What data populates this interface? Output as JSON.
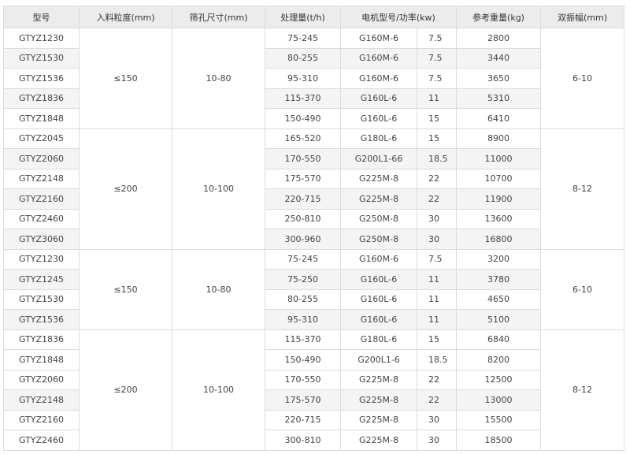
{
  "headers": [
    "型号",
    "入料粒度(mm)",
    "筛孔尺寸(mm)",
    "处理量(t/h)",
    "电机型号/功率(kw)",
    "参考重量(kg)",
    "双振幅(mm)"
  ],
  "groups": [
    {
      "feed": "≤150",
      "hole": "10-80",
      "amp": "6-10"
    },
    {
      "feed": "≤200",
      "hole": "10-100",
      "amp": "8-12"
    },
    {
      "feed": "≤150",
      "hole": "10-80",
      "amp": "6-10"
    },
    {
      "feed": "≤200",
      "hole": "10-100",
      "amp": "8-12"
    }
  ],
  "rows": [
    {
      "model": "GTYZ1230",
      "cap": "75-245",
      "motor": "G160M-6",
      "power": "7.5",
      "weight": "2800"
    },
    {
      "model": "GTYZ1530",
      "cap": "80-255",
      "motor": "G160M-6",
      "power": "7.5",
      "weight": "3440"
    },
    {
      "model": "GTYZ1536",
      "cap": "95-310",
      "motor": "G160M-6",
      "power": "7.5",
      "weight": "3650"
    },
    {
      "model": "GTYZ1836",
      "cap": "115-370",
      "motor": "G160L-6",
      "power": "11",
      "weight": "5310"
    },
    {
      "model": "GTYZ1848",
      "cap": "150-490",
      "motor": "G160L-6",
      "power": "15",
      "weight": "6410"
    },
    {
      "model": "GTYZ2045",
      "cap": "165-520",
      "motor": "G180L-6",
      "power": "15",
      "weight": "8900"
    },
    {
      "model": "GTYZ2060",
      "cap": "170-550",
      "motor": "G200L1-66",
      "power": "18.5",
      "weight": "11000"
    },
    {
      "model": "GTYZ2148",
      "cap": "175-570",
      "motor": "G225M-8",
      "power": "22",
      "weight": "10700"
    },
    {
      "model": "GTYZ2160",
      "cap": "220-715",
      "motor": "G225M-8",
      "power": "22",
      "weight": "11900"
    },
    {
      "model": "GTYZ2460",
      "cap": "250-810",
      "motor": "G250M-8",
      "power": "30",
      "weight": "13600"
    },
    {
      "model": "GTYZ3060",
      "cap": "300-960",
      "motor": "G250M-8",
      "power": "30",
      "weight": "16800"
    },
    {
      "model": "GTYZ1230",
      "cap": "75-245",
      "motor": "G160M-6",
      "power": "7.5",
      "weight": "3200"
    },
    {
      "model": "GTYZ1245",
      "cap": "75-250",
      "motor": "G160L-6",
      "power": "11",
      "weight": "3780"
    },
    {
      "model": "GTYZ1530",
      "cap": "80-255",
      "motor": "G160L-6",
      "power": "11",
      "weight": "4650"
    },
    {
      "model": "GTYZ1536",
      "cap": "95-310",
      "motor": "G160L-6",
      "power": "11",
      "weight": "5100"
    },
    {
      "model": "GTYZ1836",
      "cap": "115-370",
      "motor": "G180L-6",
      "power": "15",
      "weight": "6840"
    },
    {
      "model": "GTYZ1848",
      "cap": "150-490",
      "motor": "G200L1-6",
      "power": "18.5",
      "weight": "8200"
    },
    {
      "model": "GTYZ2060",
      "cap": "170-550",
      "motor": "G225M-8",
      "power": "22",
      "weight": "12500"
    },
    {
      "model": "GTYZ2148",
      "cap": "175-570",
      "motor": "G225M-8",
      "power": "22",
      "weight": "13000"
    },
    {
      "model": "GTYZ2160",
      "cap": "220-715",
      "motor": "G225M-8",
      "power": "30",
      "weight": "15500"
    },
    {
      "model": "GTYZ2460",
      "cap": "300-810",
      "motor": "G225M-8",
      "power": "30",
      "weight": "18500"
    }
  ]
}
